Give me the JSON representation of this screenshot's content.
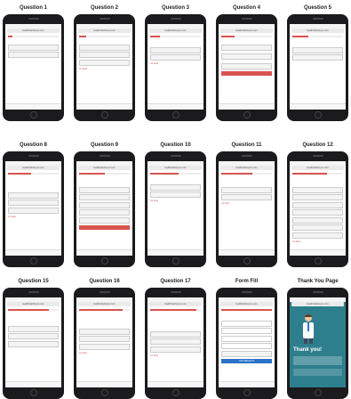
{
  "grid_labels": [
    "Question 1",
    "Question 2",
    "Question 3",
    "Question 4",
    "Question 5",
    "Question 8",
    "Question 9",
    "Question 10",
    "Question 11",
    "Question 12",
    "Question 15",
    "Question 16",
    "Question 17",
    "Form Fill",
    "Thank You Page"
  ],
  "common": {
    "url": "healthtrialsforyou.com",
    "back": "Go back",
    "submit": "GET RESULTS"
  },
  "thank_you": {
    "title": "Thank you!"
  },
  "colors": {
    "accent": "#d9534f",
    "phone": "#1b1b1d",
    "submit": "#2a73c9",
    "thankyou_bg": "#2e7f8e"
  }
}
